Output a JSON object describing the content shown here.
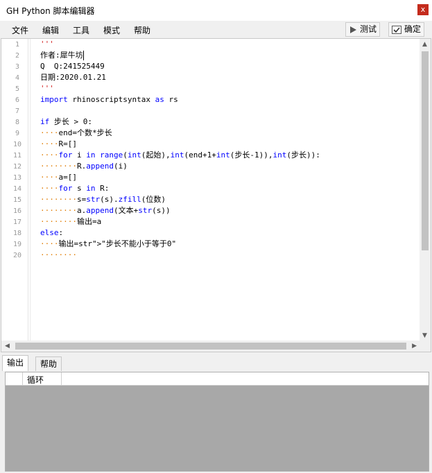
{
  "window": {
    "title": "GH Python 脚本编辑器",
    "close_label": "x"
  },
  "menu": [
    "文件",
    "编辑",
    "工具",
    "模式",
    "帮助"
  ],
  "toolbar": {
    "test_label": "测试",
    "confirm_label": "确定"
  },
  "editor": {
    "line_numbers": [
      "1",
      "2",
      "3",
      "4",
      "5",
      "6",
      "7",
      "8",
      "9",
      "10",
      "11",
      "12",
      "13",
      "14",
      "15",
      "16",
      "17",
      "18",
      "19",
      "20"
    ],
    "lines": [
      "'''",
      "作者:犀牛坊",
      "Q  Q:241525449",
      "日期:2020.01.21",
      "'''",
      "import rhinoscriptsyntax as rs",
      "",
      "if 步长 > 0:",
      "····end=个数*步长",
      "····R=[]",
      "····for i in range(int(起始),int(end+1+int(步长-1)),int(步长)):",
      "········R.append(i)",
      "····a=[]",
      "····for s in R:",
      "········s=str(s).zfill(位数)",
      "········a.append(文本+str(s))",
      "········输出=a",
      "else:",
      "····输出=\"步长不能小于等于0\"",
      "········"
    ]
  },
  "bottom_tabs": [
    "输出",
    "帮助"
  ],
  "output": {
    "header": "循环"
  },
  "icons": {
    "test": "play-icon",
    "confirm": "checkmark-icon"
  }
}
